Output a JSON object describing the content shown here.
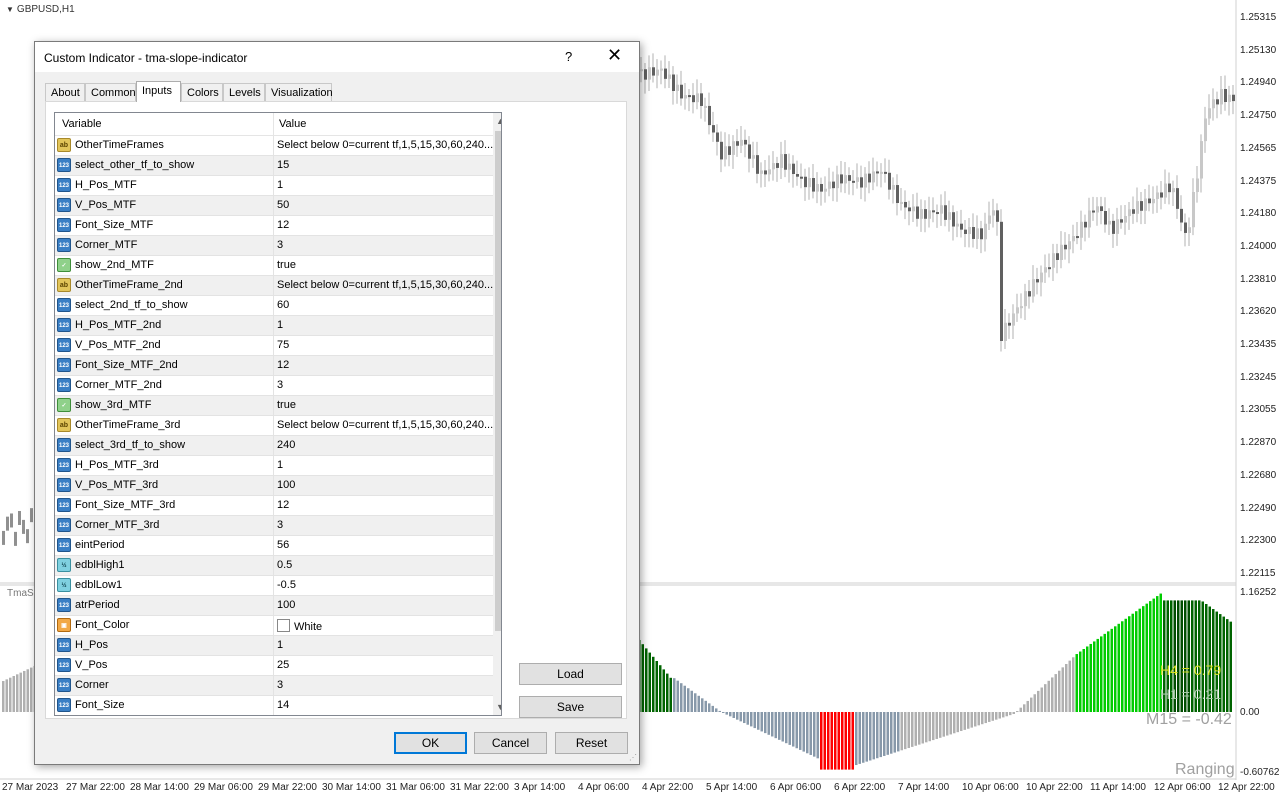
{
  "chart": {
    "symbol_title": "GBPUSD,H1",
    "subwindow_label": "TmaSl",
    "price_labels": [
      "1.25315",
      "1.25130",
      "1.24940",
      "1.24750",
      "1.24565",
      "1.24375",
      "1.24180",
      "1.24000",
      "1.23810",
      "1.23620",
      "1.23435",
      "1.23245",
      "1.23055",
      "1.22870",
      "1.22680",
      "1.22490",
      "1.22300",
      "1.22115"
    ],
    "sub_labels": [
      "1.16252",
      "0.00",
      "-0.60762"
    ],
    "time_labels": [
      "27 Mar 2023",
      "27 Mar 22:00",
      "28 Mar 14:00",
      "29 Mar 06:00",
      "29 Mar 22:00",
      "30 Mar 14:00",
      "31 Mar 06:00",
      "31 Mar 22:00",
      "3 Apr 14:00",
      "4 Apr 06:00",
      "4 Apr 22:00",
      "5 Apr 14:00",
      "6 Apr 06:00",
      "6 Apr 22:00",
      "7 Apr 14:00",
      "10 Apr 06:00",
      "10 Apr 22:00",
      "11 Apr 14:00",
      "12 Apr 06:00",
      "12 Apr 22:00"
    ],
    "overlay": {
      "h4": "H4 = 0.79",
      "h1": "H1 = 0.21",
      "m15": "M15 = -0.42",
      "state": "Ranging"
    }
  },
  "dialog": {
    "title": "Custom Indicator - tma-slope-indicator",
    "help": "?",
    "close": "✕",
    "tabs": [
      "About",
      "Common",
      "Inputs",
      "Colors",
      "Levels",
      "Visualization"
    ],
    "active_tab": "Inputs",
    "columns": {
      "variable": "Variable",
      "value": "Value"
    },
    "rows": [
      {
        "type": "str",
        "icon": "ab",
        "name": "OtherTimeFrames",
        "value": "Select below 0=current tf,1,5,15,30,60,240..."
      },
      {
        "type": "int",
        "icon": "123",
        "name": "select_other_tf_to_show",
        "value": "15"
      },
      {
        "type": "int",
        "icon": "123",
        "name": "H_Pos_MTF",
        "value": "1"
      },
      {
        "type": "int",
        "icon": "123",
        "name": "V_Pos_MTF",
        "value": "50"
      },
      {
        "type": "int",
        "icon": "123",
        "name": "Font_Size_MTF",
        "value": "12"
      },
      {
        "type": "int",
        "icon": "123",
        "name": "Corner_MTF",
        "value": "3"
      },
      {
        "type": "bool",
        "icon": "✓",
        "name": "show_2nd_MTF",
        "value": "true"
      },
      {
        "type": "str",
        "icon": "ab",
        "name": "OtherTimeFrame_2nd",
        "value": "Select below 0=current tf,1,5,15,30,60,240..."
      },
      {
        "type": "int",
        "icon": "123",
        "name": "select_2nd_tf_to_show",
        "value": "60"
      },
      {
        "type": "int",
        "icon": "123",
        "name": "H_Pos_MTF_2nd",
        "value": "1"
      },
      {
        "type": "int",
        "icon": "123",
        "name": "V_Pos_MTF_2nd",
        "value": "75"
      },
      {
        "type": "int",
        "icon": "123",
        "name": "Font_Size_MTF_2nd",
        "value": "12"
      },
      {
        "type": "int",
        "icon": "123",
        "name": "Corner_MTF_2nd",
        "value": "3"
      },
      {
        "type": "bool",
        "icon": "✓",
        "name": "show_3rd_MTF",
        "value": "true"
      },
      {
        "type": "str",
        "icon": "ab",
        "name": "OtherTimeFrame_3rd",
        "value": "Select below 0=current tf,1,5,15,30,60,240..."
      },
      {
        "type": "int",
        "icon": "123",
        "name": "select_3rd_tf_to_show",
        "value": "240"
      },
      {
        "type": "int",
        "icon": "123",
        "name": "H_Pos_MTF_3rd",
        "value": "1"
      },
      {
        "type": "int",
        "icon": "123",
        "name": "V_Pos_MTF_3rd",
        "value": "100"
      },
      {
        "type": "int",
        "icon": "123",
        "name": "Font_Size_MTF_3rd",
        "value": "12"
      },
      {
        "type": "int",
        "icon": "123",
        "name": "Corner_MTF_3rd",
        "value": "3"
      },
      {
        "type": "int",
        "icon": "123",
        "name": "eintPeriod",
        "value": "56"
      },
      {
        "type": "dbl",
        "icon": "½",
        "name": "edblHigh1",
        "value": "0.5"
      },
      {
        "type": "dbl",
        "icon": "½",
        "name": "edblLow1",
        "value": "-0.5"
      },
      {
        "type": "int",
        "icon": "123",
        "name": "atrPeriod",
        "value": "100"
      },
      {
        "type": "col",
        "icon": "▣",
        "name": "Font_Color",
        "value": "White",
        "swatch": "#ffffff"
      },
      {
        "type": "int",
        "icon": "123",
        "name": "H_Pos",
        "value": "1"
      },
      {
        "type": "int",
        "icon": "123",
        "name": "V_Pos",
        "value": "25"
      },
      {
        "type": "int",
        "icon": "123",
        "name": "Corner",
        "value": "3"
      },
      {
        "type": "int",
        "icon": "123",
        "name": "Font_Size",
        "value": "14"
      }
    ],
    "buttons": {
      "load": "Load",
      "save": "Save",
      "ok": "OK",
      "cancel": "Cancel",
      "reset": "Reset"
    }
  },
  "colors": {
    "bull": "#00cc00",
    "bull_dark": "#006400",
    "bear": "#ff0000",
    "neutral": "#8899aa",
    "neutral_light": "#b0b0b0"
  }
}
